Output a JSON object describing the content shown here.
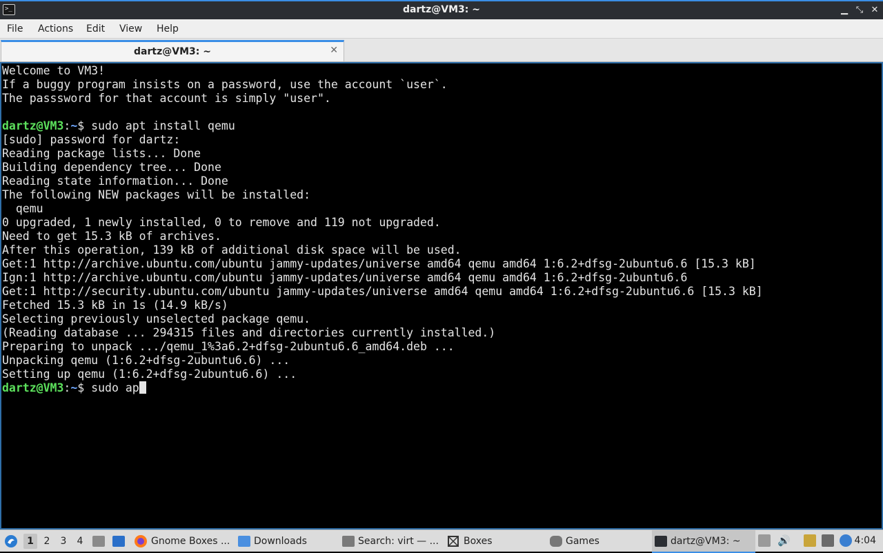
{
  "window": {
    "title": "dartz@VM3: ~",
    "controls": {
      "minimize": "▁",
      "restore": "⤡",
      "close": "✕"
    }
  },
  "menu": [
    "File",
    "Actions",
    "Edit",
    "View",
    "Help"
  ],
  "tab": {
    "title": "dartz@VM3: ~",
    "close": "✕"
  },
  "terminal": {
    "prompt_user": "dartz@VM3",
    "prompt_path": "~",
    "lines": [
      "Welcome to VM3!",
      "If a buggy program insists on a password, use the account `user`.",
      "The passsword for that account is simply \"user\".",
      "",
      "$ sudo apt install qemu",
      "[sudo] password for dartz:",
      "Reading package lists... Done",
      "Building dependency tree... Done",
      "Reading state information... Done",
      "The following NEW packages will be installed:",
      "  qemu",
      "0 upgraded, 1 newly installed, 0 to remove and 119 not upgraded.",
      "Need to get 15.3 kB of archives.",
      "After this operation, 139 kB of additional disk space will be used.",
      "Get:1 http://archive.ubuntu.com/ubuntu jammy-updates/universe amd64 qemu amd64 1:6.2+dfsg-2ubuntu6.6 [15.3 kB]",
      "Ign:1 http://archive.ubuntu.com/ubuntu jammy-updates/universe amd64 qemu amd64 1:6.2+dfsg-2ubuntu6.6",
      "Get:1 http://security.ubuntu.com/ubuntu jammy-updates/universe amd64 qemu amd64 1:6.2+dfsg-2ubuntu6.6 [15.3 kB]",
      "Fetched 15.3 kB in 1s (14.9 kB/s)",
      "Selecting previously unselected package qemu.",
      "(Reading database ... 294315 files and directories currently installed.)",
      "Preparing to unpack .../qemu_1%3a6.2+dfsg-2ubuntu6.6_amd64.deb ...",
      "Unpacking qemu (1:6.2+dfsg-2ubuntu6.6) ...",
      "Setting up qemu (1:6.2+dfsg-2ubuntu6.6) ..."
    ],
    "current_input": "$ sudo ap"
  },
  "taskbar": {
    "workspaces": [
      "1",
      "2",
      "3",
      "4"
    ],
    "active_workspace": "1",
    "tasks": [
      {
        "label": "Gnome Boxes ...",
        "icon": "firefox-icon"
      },
      {
        "label": "Downloads",
        "icon": "folder-icon"
      },
      {
        "label": "Search: virt — ...",
        "icon": "search-app-icon"
      },
      {
        "label": "Boxes",
        "icon": "boxes-icon"
      },
      {
        "label": "Games",
        "icon": "gamepad-icon"
      },
      {
        "label": "dartz@VM3: ~",
        "icon": "terminal-icon",
        "active": true
      }
    ],
    "clock": "4:04"
  },
  "colors": {
    "accent": "#3a8ee6",
    "prompt_user": "#5ce05c",
    "prompt_path": "#6fa8ff",
    "terminal_bg": "#000000",
    "terminal_fg": "#e5e5e5"
  }
}
